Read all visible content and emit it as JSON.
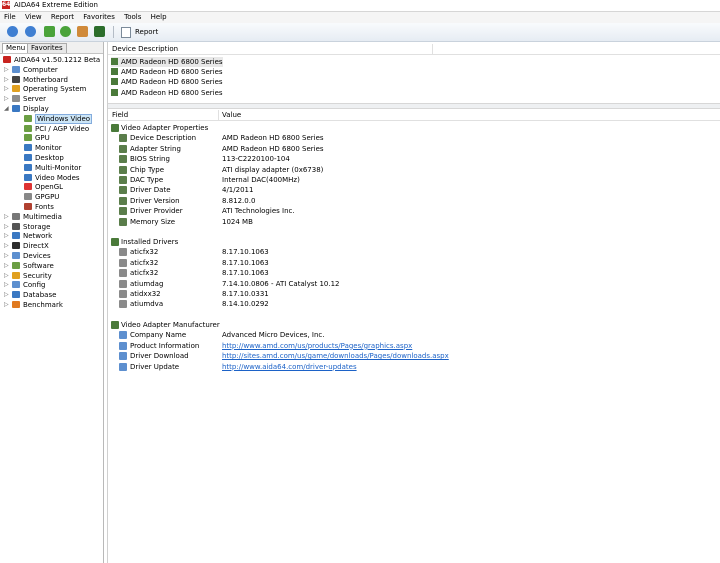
{
  "window": {
    "title": "AIDA64 Extreme Edition",
    "icon_letter": "64"
  },
  "menu": [
    "File",
    "View",
    "Report",
    "Favorites",
    "Tools",
    "Help"
  ],
  "toolbar": {
    "icons": [
      "back-icon",
      "forward-icon",
      "up-icon",
      "refresh-icon",
      "users-icon",
      "chart-icon"
    ],
    "report_label": "Report"
  },
  "left": {
    "tabs": [
      "Menu",
      "Favorites"
    ],
    "tree": [
      {
        "label": "AIDA64 v1.50.1212 Beta",
        "level": 0,
        "exp": "",
        "color": "#c8231f"
      },
      {
        "label": "Computer",
        "level": 1,
        "exp": "▷",
        "color": "#5d8fcf"
      },
      {
        "label": "Motherboard",
        "level": 1,
        "exp": "▷",
        "color": "#444"
      },
      {
        "label": "Operating System",
        "level": 1,
        "exp": "▷",
        "color": "#e0a020"
      },
      {
        "label": "Server",
        "level": 1,
        "exp": "▷",
        "color": "#8d8d8d"
      },
      {
        "label": "Display",
        "level": 1,
        "exp": "◢",
        "color": "#3a78c2"
      },
      {
        "label": "Windows Video",
        "level": 2,
        "exp": "",
        "color": "#6b9e43",
        "selected": true
      },
      {
        "label": "PCI / AGP Video",
        "level": 2,
        "exp": "",
        "color": "#6b9e43"
      },
      {
        "label": "GPU",
        "level": 2,
        "exp": "",
        "color": "#6b9e43"
      },
      {
        "label": "Monitor",
        "level": 2,
        "exp": "",
        "color": "#3a78c2"
      },
      {
        "label": "Desktop",
        "level": 2,
        "exp": "",
        "color": "#3a78c2"
      },
      {
        "label": "Multi-Monitor",
        "level": 2,
        "exp": "",
        "color": "#3a78c2"
      },
      {
        "label": "Video Modes",
        "level": 2,
        "exp": "",
        "color": "#3a78c2"
      },
      {
        "label": "OpenGL",
        "level": 2,
        "exp": "",
        "color": "#d33"
      },
      {
        "label": "GPGPU",
        "level": 2,
        "exp": "",
        "color": "#888"
      },
      {
        "label": "Fonts",
        "level": 2,
        "exp": "",
        "color": "#b04030"
      },
      {
        "label": "Multimedia",
        "level": 1,
        "exp": "▷",
        "color": "#777"
      },
      {
        "label": "Storage",
        "level": 1,
        "exp": "▷",
        "color": "#555"
      },
      {
        "label": "Network",
        "level": 1,
        "exp": "▷",
        "color": "#3a78c2"
      },
      {
        "label": "DirectX",
        "level": 1,
        "exp": "▷",
        "color": "#2d2d2d"
      },
      {
        "label": "Devices",
        "level": 1,
        "exp": "▷",
        "color": "#5d8fcf"
      },
      {
        "label": "Software",
        "level": 1,
        "exp": "▷",
        "color": "#6b9e43"
      },
      {
        "label": "Security",
        "level": 1,
        "exp": "▷",
        "color": "#e0a020"
      },
      {
        "label": "Config",
        "level": 1,
        "exp": "▷",
        "color": "#5d8fcf"
      },
      {
        "label": "Database",
        "level": 1,
        "exp": "▷",
        "color": "#3a78c2"
      },
      {
        "label": "Benchmark",
        "level": 1,
        "exp": "▷",
        "color": "#e07a20"
      }
    ]
  },
  "right": {
    "device_header": "Device Description",
    "devices": [
      "AMD Radeon HD 6800 Series",
      "AMD Radeon HD 6800 Series",
      "AMD Radeon HD 6800 Series",
      "AMD Radeon HD 6800 Series"
    ],
    "field_header": "Field",
    "value_header": "Value",
    "groups": [
      {
        "title": "Video Adapter Properties",
        "rows": [
          {
            "field": "Device Description",
            "value": "AMD Radeon HD 6800 Series"
          },
          {
            "field": "Adapter String",
            "value": "AMD Radeon HD 6800 Series"
          },
          {
            "field": "BIOS String",
            "value": "113-C2220100-104"
          },
          {
            "field": "Chip Type",
            "value": "ATI display adapter (0x6738)"
          },
          {
            "field": "DAC Type",
            "value": "Internal DAC(400MHz)"
          },
          {
            "field": "Driver Date",
            "value": "4/1/2011"
          },
          {
            "field": "Driver Version",
            "value": "8.812.0.0"
          },
          {
            "field": "Driver Provider",
            "value": "ATI Technologies Inc."
          },
          {
            "field": "Memory Size",
            "value": "1024 MB"
          }
        ]
      },
      {
        "title": "Installed Drivers",
        "rows": [
          {
            "field": "aticfx32",
            "value": "8.17.10.1063"
          },
          {
            "field": "aticfx32",
            "value": "8.17.10.1063"
          },
          {
            "field": "aticfx32",
            "value": "8.17.10.1063"
          },
          {
            "field": "atiumdag",
            "value": "7.14.10.0806 - ATI Catalyst 10.12"
          },
          {
            "field": "atidxx32",
            "value": "8.17.10.0331"
          },
          {
            "field": "atiumdva",
            "value": "8.14.10.0292"
          }
        ]
      },
      {
        "title": "Video Adapter Manufacturer",
        "rows": [
          {
            "field": "Company Name",
            "value": "Advanced Micro Devices, Inc."
          },
          {
            "field": "Product Information",
            "value": "http://www.amd.com/us/products/Pages/graphics.aspx",
            "link": true
          },
          {
            "field": "Driver Download",
            "value": "http://sites.amd.com/us/game/downloads/Pages/downloads.aspx",
            "link": true
          },
          {
            "field": "Driver Update",
            "value": "http://www.aida64.com/driver-updates",
            "link": true
          }
        ]
      }
    ]
  }
}
